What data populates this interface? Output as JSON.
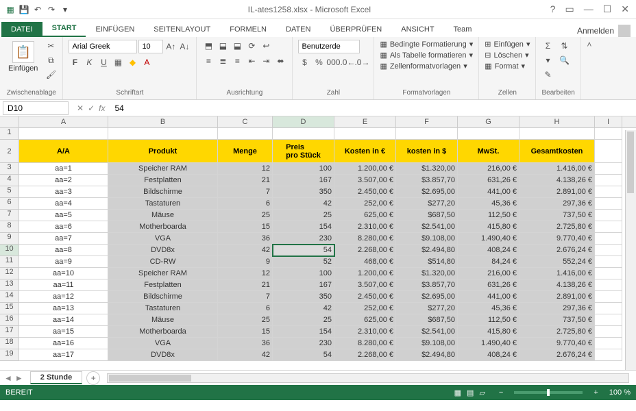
{
  "app": {
    "title": "IL-ates1258.xlsx - Microsoft Excel"
  },
  "login": "Anmelden",
  "tabs": {
    "file": "DATEI",
    "start": "START",
    "einfuegen": "EINFÜGEN",
    "seitenlayout": "SEITENLAYOUT",
    "formeln": "FORMELN",
    "daten": "DATEN",
    "ueberpruefen": "ÜBERPRÜFEN",
    "ansicht": "ANSICHT",
    "team": "Team"
  },
  "ribbon": {
    "clipboard": {
      "paste": "Einfügen",
      "label": "Zwischenablage"
    },
    "font": {
      "name": "Arial Greek",
      "size": "10",
      "label": "Schriftart"
    },
    "align": {
      "label": "Ausrichtung"
    },
    "number": {
      "format": "Benutzerde",
      "label": "Zahl"
    },
    "styles": {
      "cond": "Bedingte Formatierung",
      "table": "Als Tabelle formatieren",
      "cell": "Zellenformatvorlagen",
      "label": "Formatvorlagen"
    },
    "cells": {
      "insert": "Einfügen",
      "delete": "Löschen",
      "format": "Format",
      "label": "Zellen"
    },
    "editing": {
      "label": "Bearbeiten"
    }
  },
  "formula": {
    "nameBox": "D10",
    "value": "54"
  },
  "colHeaders": [
    "A",
    "B",
    "C",
    "D",
    "E",
    "F",
    "G",
    "H",
    "I"
  ],
  "header2": {
    "A": "A/A",
    "B": "Produkt",
    "C": "Menge",
    "D1": "Preis",
    "D2": "pro Stück",
    "E": "Kosten in €",
    "F": "kosten in $",
    "G": "MwSt.",
    "H": "Gesamtkosten"
  },
  "rows": [
    {
      "r": 3,
      "A": "aa=1",
      "B": "Speicher RAM",
      "C": "12",
      "D": "100",
      "E": "1.200,00 €",
      "F": "$1.320,00",
      "G": "216,00 €",
      "H": "1.416,00 €"
    },
    {
      "r": 4,
      "A": "aa=2",
      "B": "Festplatten",
      "C": "21",
      "D": "167",
      "E": "3.507,00 €",
      "F": "$3.857,70",
      "G": "631,26 €",
      "H": "4.138,26 €"
    },
    {
      "r": 5,
      "A": "aa=3",
      "B": "Bildschirme",
      "C": "7",
      "D": "350",
      "E": "2.450,00 €",
      "F": "$2.695,00",
      "G": "441,00 €",
      "H": "2.891,00 €"
    },
    {
      "r": 6,
      "A": "aa=4",
      "B": "Tastaturen",
      "C": "6",
      "D": "42",
      "E": "252,00 €",
      "F": "$277,20",
      "G": "45,36 €",
      "H": "297,36 €"
    },
    {
      "r": 7,
      "A": "aa=5",
      "B": "Mäuse",
      "C": "25",
      "D": "25",
      "E": "625,00 €",
      "F": "$687,50",
      "G": "112,50 €",
      "H": "737,50 €"
    },
    {
      "r": 8,
      "A": "aa=6",
      "B": "Motherboarda",
      "C": "15",
      "D": "154",
      "E": "2.310,00 €",
      "F": "$2.541,00",
      "G": "415,80 €",
      "H": "2.725,80 €"
    },
    {
      "r": 9,
      "A": "aa=7",
      "B": "VGA",
      "C": "36",
      "D": "230",
      "E": "8.280,00 €",
      "F": "$9.108,00",
      "G": "1.490,40 €",
      "H": "9.770,40 €"
    },
    {
      "r": 10,
      "A": "aa=8",
      "B": "DVD8x",
      "C": "42",
      "D": "54",
      "E": "2.268,00 €",
      "F": "$2.494,80",
      "G": "408,24 €",
      "H": "2.676,24 €"
    },
    {
      "r": 11,
      "A": "aa=9",
      "B": "CD-RW",
      "C": "9",
      "D": "52",
      "E": "468,00 €",
      "F": "$514,80",
      "G": "84,24 €",
      "H": "552,24 €"
    },
    {
      "r": 12,
      "A": "aa=10",
      "B": "Speicher RAM",
      "C": "12",
      "D": "100",
      "E": "1.200,00 €",
      "F": "$1.320,00",
      "G": "216,00 €",
      "H": "1.416,00 €"
    },
    {
      "r": 13,
      "A": "aa=11",
      "B": "Festplatten",
      "C": "21",
      "D": "167",
      "E": "3.507,00 €",
      "F": "$3.857,70",
      "G": "631,26 €",
      "H": "4.138,26 €"
    },
    {
      "r": 14,
      "A": "aa=12",
      "B": "Bildschirme",
      "C": "7",
      "D": "350",
      "E": "2.450,00 €",
      "F": "$2.695,00",
      "G": "441,00 €",
      "H": "2.891,00 €"
    },
    {
      "r": 15,
      "A": "aa=13",
      "B": "Tastaturen",
      "C": "6",
      "D": "42",
      "E": "252,00 €",
      "F": "$277,20",
      "G": "45,36 €",
      "H": "297,36 €"
    },
    {
      "r": 16,
      "A": "aa=14",
      "B": "Mäuse",
      "C": "25",
      "D": "25",
      "E": "625,00 €",
      "F": "$687,50",
      "G": "112,50 €",
      "H": "737,50 €"
    },
    {
      "r": 17,
      "A": "aa=15",
      "B": "Motherboarda",
      "C": "15",
      "D": "154",
      "E": "2.310,00 €",
      "F": "$2.541,00",
      "G": "415,80 €",
      "H": "2.725,80 €"
    },
    {
      "r": 18,
      "A": "aa=16",
      "B": "VGA",
      "C": "36",
      "D": "230",
      "E": "8.280,00 €",
      "F": "$9.108,00",
      "G": "1.490,40 €",
      "H": "9.770,40 €"
    },
    {
      "r": 19,
      "A": "aa=17",
      "B": "DVD8x",
      "C": "42",
      "D": "54",
      "E": "2.268,00 €",
      "F": "$2.494,80",
      "G": "408,24 €",
      "H": "2.676,24 €"
    }
  ],
  "sheet": {
    "name": "2 Stunde"
  },
  "status": {
    "ready": "BEREIT",
    "zoom": "100 %"
  }
}
